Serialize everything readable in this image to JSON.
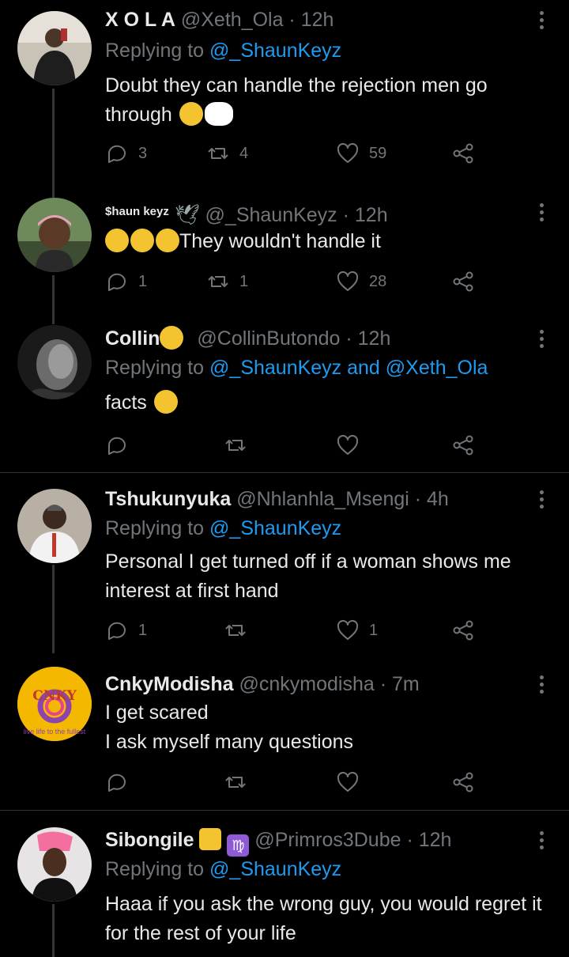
{
  "tweets": [
    {
      "name": "X O L A",
      "handle": "@Xeth_Ola · 12h",
      "replying_prefix": "Replying to ",
      "replying_to": "@_ShaunKeyz",
      "text": "Doubt they can handle the rejection men go through",
      "reply_count": "3",
      "retweet_count": "4",
      "like_count": "59"
    },
    {
      "name": "$haun keyz",
      "handle": "@_ShaunKeyz · 12h",
      "text": "They wouldn't handle it",
      "reply_count": "1",
      "retweet_count": "1",
      "like_count": "28"
    },
    {
      "name": "Collin",
      "handle": "@CollinButondo · 12h",
      "replying_prefix": "Replying to ",
      "replying_to": "@_ShaunKeyz and @Xeth_Ola",
      "text": "facts",
      "reply_count": "",
      "retweet_count": "",
      "like_count": ""
    },
    {
      "name": "Tshukunyuka",
      "handle": "@Nhlanhla_Msengi · 4h",
      "replying_prefix": "Replying to ",
      "replying_to": "@_ShaunKeyz",
      "text": "Personal I get turned off if a woman shows me interest at first hand",
      "reply_count": "1",
      "retweet_count": "",
      "like_count": "1"
    },
    {
      "name": "CnkyModisha",
      "handle": "@cnkymodisha · 7m",
      "text_line1": "I get scared",
      "text_line2": "I ask myself many questions",
      "reply_count": "",
      "retweet_count": "",
      "like_count": "",
      "avatar_text": "CNKY",
      "avatar_tagline": "live life to the fullest"
    },
    {
      "name": "Sibongile",
      "handle": "@Primros3Dube · 12h",
      "replying_prefix": "Replying to ",
      "replying_to": "@_ShaunKeyz",
      "text": "Haaa if you ask the wrong guy, you would regret it for the rest of your life",
      "badge_virgo": "♍"
    }
  ],
  "icons": [
    "reply-icon",
    "retweet-icon",
    "like-icon",
    "share-icon",
    "more-icon"
  ],
  "colors": {
    "background": "#000000",
    "text": "#e7e9ea",
    "secondary": "#71767b",
    "link": "#1d9bf0",
    "divider": "#2f3336"
  }
}
